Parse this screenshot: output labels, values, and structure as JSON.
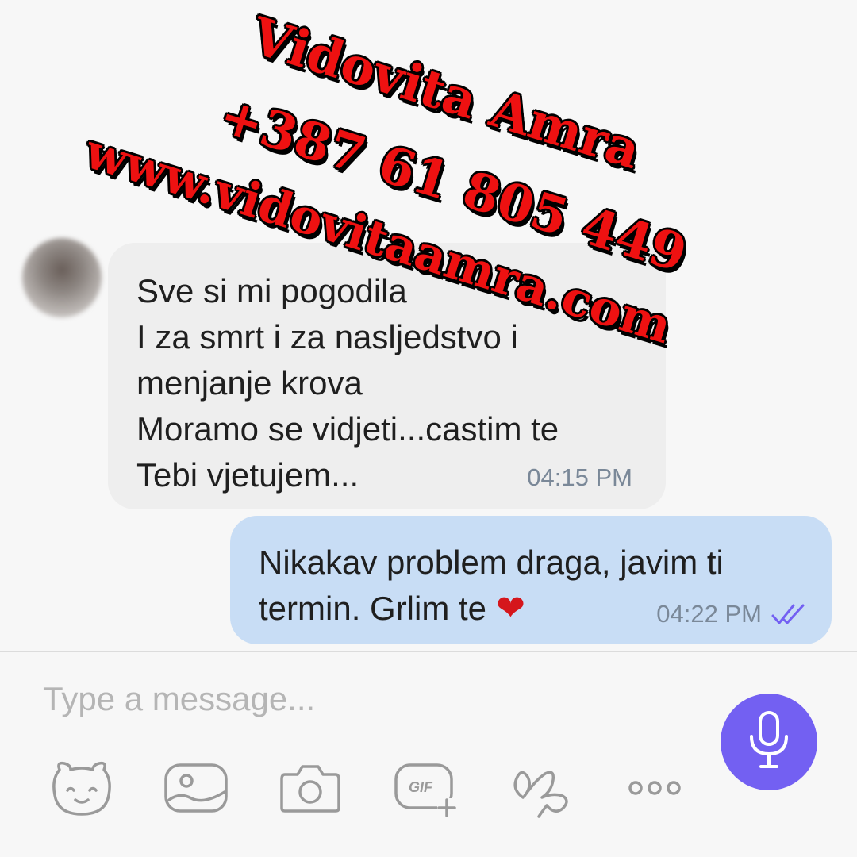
{
  "incoming_message": {
    "lines": [
      "Sve si mi pogodila",
      "I za smrt i za nasljedstvo i",
      "menjanje krova",
      "Moramo se vidjeti...castim te",
      "Tebi vjetujem..."
    ],
    "time": "04:15 PM"
  },
  "outgoing_message": {
    "lines": [
      "Nikakav problem draga, javim ti",
      "termin. Grlim te"
    ],
    "emoji": "❤",
    "time": "04:22 PM",
    "status_icon": "double-check-icon"
  },
  "composer": {
    "placeholder": "Type a message..."
  },
  "toolbar": {
    "icons": [
      "sticker-icon",
      "gallery-icon",
      "camera-icon",
      "gif-icon",
      "doodle-icon",
      "more-icon"
    ],
    "gif_label": "GIF",
    "more_label": "ooo"
  },
  "watermark": {
    "line1": "Vidovita Amra",
    "line2": "+387 61 805 449",
    "line3": "www.vidovitaamra.com"
  },
  "colors": {
    "accent": "#7360f2",
    "outgoing_bubble": "#c8ddf5",
    "incoming_bubble": "#eeeeee",
    "watermark": "#ee1111"
  }
}
